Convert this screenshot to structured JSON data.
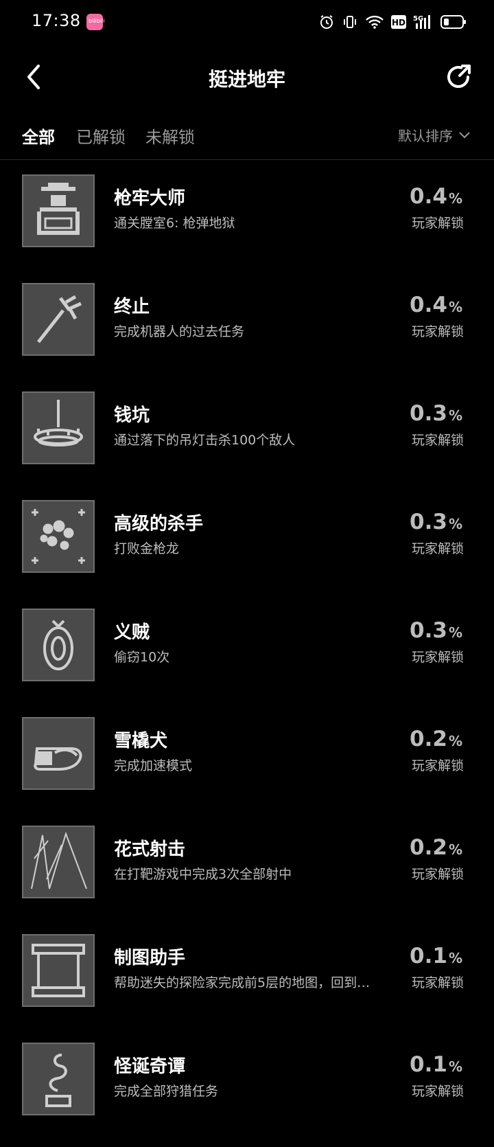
{
  "status_bar": {
    "time": "17:38",
    "app_badge": "bilibili",
    "icons": [
      "alarm-icon",
      "vibrate-icon",
      "wifi-icon",
      "hd-icon",
      "signal-5g-icon",
      "battery-icon"
    ],
    "hd_label": "HD",
    "network_label": "5G"
  },
  "navbar": {
    "back_icon": "chevron-left-icon",
    "title": "挺进地牢",
    "share_icon": "share-icon"
  },
  "tabs": {
    "items": [
      {
        "label": "全部",
        "active": true
      },
      {
        "label": "已解锁",
        "active": false
      },
      {
        "label": "未解锁",
        "active": false
      }
    ],
    "sort_label": "默认排序",
    "sort_icon": "chevron-down-icon"
  },
  "achievements": [
    {
      "title": "枪牢大师",
      "desc": "通关膛室6: 枪弹地狱",
      "percent": "0.4",
      "unit": "%",
      "percent_label": "玩家解锁",
      "icon": "gundead-chest-icon"
    },
    {
      "title": "终止",
      "desc": "完成机器人的过去任务",
      "percent": "0.4",
      "unit": "%",
      "percent_label": "玩家解锁",
      "icon": "robot-arm-icon"
    },
    {
      "title": "钱坑",
      "desc": "通过落下的吊灯击杀100个敌人",
      "percent": "0.3",
      "unit": "%",
      "percent_label": "玩家解锁",
      "icon": "chandelier-icon"
    },
    {
      "title": "高级的杀手",
      "desc": "打败金枪龙",
      "percent": "0.3",
      "unit": "%",
      "percent_label": "玩家解锁",
      "icon": "dragon-skull-icon"
    },
    {
      "title": "义贼",
      "desc": "偷窃10次",
      "percent": "0.3",
      "unit": "%",
      "percent_label": "玩家解锁",
      "icon": "mirror-icon"
    },
    {
      "title": "雪橇犬",
      "desc": "完成加速模式",
      "percent": "0.2",
      "unit": "%",
      "percent_label": "玩家解锁",
      "icon": "sled-icon"
    },
    {
      "title": "花式射击",
      "desc": "在打靶游戏中完成3次全部射中",
      "percent": "0.2",
      "unit": "%",
      "percent_label": "玩家解锁",
      "icon": "trick-shot-icon"
    },
    {
      "title": "制图助手",
      "desc": "帮助迷失的探险家完成前5层的地图，回到…",
      "percent": "0.1",
      "unit": "%",
      "percent_label": "玩家解锁",
      "icon": "scroll-map-icon"
    },
    {
      "title": "怪诞奇谭",
      "desc": "完成全部狩猎任务",
      "percent": "0.1",
      "unit": "%",
      "percent_label": "玩家解锁",
      "icon": "serpent-icon"
    }
  ]
}
